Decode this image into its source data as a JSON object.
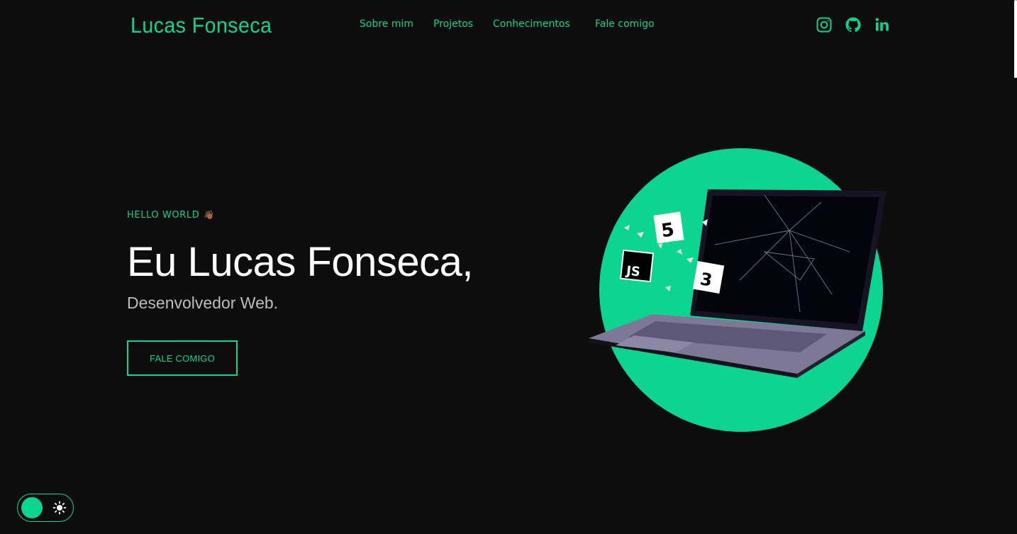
{
  "brand": {
    "name": "Lucas Fonseca",
    "accent": "#0cd491",
    "background": "#0d0d0d"
  },
  "nav": {
    "items": [
      {
        "label": "Sobre mim"
      },
      {
        "label": "Projetos"
      },
      {
        "label": "Conhecimentos"
      },
      {
        "label": "Fale comigo"
      }
    ]
  },
  "socials": [
    {
      "icon": "instagram-icon"
    },
    {
      "icon": "github-icon"
    },
    {
      "icon": "linkedin-icon"
    }
  ],
  "hero": {
    "greeting": "HELLO WORLD",
    "greeting_emoji": "👋🏾",
    "title": "Eu Lucas Fonseca,",
    "subtitle": "Desenvolvedor Web.",
    "cta_label": "FALE COMIGO",
    "art_badges": [
      "5",
      "JS",
      "3"
    ]
  },
  "theme_toggle": {
    "state": "dark",
    "icon": "sun-icon"
  }
}
